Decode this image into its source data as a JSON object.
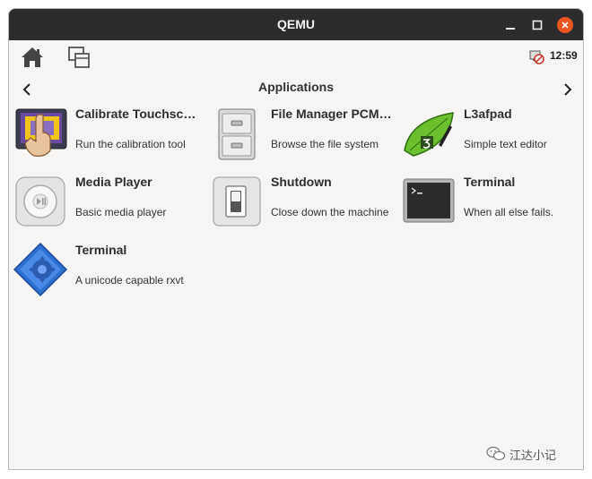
{
  "window": {
    "title": "QEMU"
  },
  "toolbar": {
    "clock": "12:59"
  },
  "navbar": {
    "title": "Applications"
  },
  "apps": [
    {
      "name": "Calibrate Touchscreen",
      "description": "Run the calibration tool",
      "icon": "touchscreen-calibration-icon"
    },
    {
      "name": "File Manager PCManFM",
      "description": "Browse the file system",
      "icon": "file-cabinet-icon"
    },
    {
      "name": "L3afpad",
      "description": "Simple text editor",
      "icon": "text-editor-leaf-icon"
    },
    {
      "name": "Media Player",
      "description": "Basic media player",
      "icon": "media-player-icon"
    },
    {
      "name": "Shutdown",
      "description": "Close down the machine",
      "icon": "power-switch-icon"
    },
    {
      "name": "Terminal",
      "description": "When all else fails.",
      "icon": "terminal-icon"
    },
    {
      "name": "Terminal",
      "description": "A unicode capable rxvt",
      "icon": "rxvt-terminal-icon"
    }
  ],
  "watermark": {
    "text": "江达小记"
  },
  "colors": {
    "titlebar": "#2c2c2c",
    "close": "#e95420",
    "background": "#f6f5f4"
  }
}
